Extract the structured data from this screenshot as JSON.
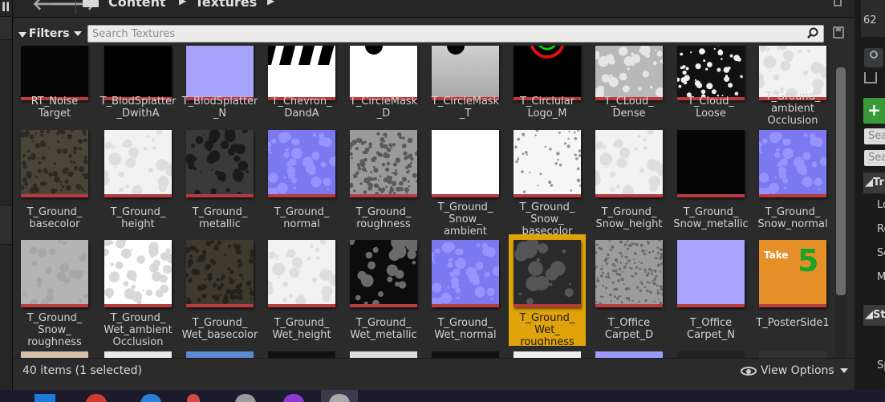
{
  "left_panel": {
    "menu_glyph": "ll"
  },
  "path": {
    "back_label": "🡐",
    "forward_label": "🡒",
    "crumbs": [
      "Content",
      "Textures"
    ]
  },
  "toolbar": {
    "filters_label": "Filters",
    "search_placeholder": "Search Textures"
  },
  "assets": [
    {
      "name": "RT_Noise\nTarget",
      "thumb": "black"
    },
    {
      "name": "T_BlodSplatter\n_DwithA",
      "thumb": "blood"
    },
    {
      "name": "T_BlodSplatter\n_N",
      "thumb": "blue-splat"
    },
    {
      "name": "T_Chevron_\nDandA",
      "thumb": "chevron"
    },
    {
      "name": "T_CircleMask\n_D",
      "thumb": "circle-white"
    },
    {
      "name": "T_CircleMask\n_T",
      "thumb": "circle-gray"
    },
    {
      "name": "T_Circlular\nLogo_M",
      "thumb": "logo"
    },
    {
      "name": "T_CLoud_\nDense",
      "thumb": "cloud-dense"
    },
    {
      "name": "T_Cloud_\nLoose",
      "thumb": "cloud-loose"
    },
    {
      "name": "T_Ground_\nambient\nOcclusion",
      "thumb": "white-rough"
    },
    {
      "name": "T_Ground_\nbasecolor",
      "thumb": "dirt"
    },
    {
      "name": "T_Ground_\nheight",
      "thumb": "white-rough"
    },
    {
      "name": "T_Ground_\nmetallic",
      "thumb": "dark-gray"
    },
    {
      "name": "T_Ground_\nnormal",
      "thumb": "normal"
    },
    {
      "name": "T_Ground_\nroughness",
      "thumb": "gray-noise"
    },
    {
      "name": "T_Ground_\nSnow_\nambient",
      "thumb": "white"
    },
    {
      "name": "T_Ground_\nSnow_\nbasecolor",
      "thumb": "snow-speck"
    },
    {
      "name": "T_Ground_\nSnow_height",
      "thumb": "white-rough"
    },
    {
      "name": "T_Ground_\nSnow_metallic",
      "thumb": "black"
    },
    {
      "name": "T_Ground_\nSnow_normal",
      "thumb": "normal"
    },
    {
      "name": "T_Ground_\nSnow_\nroughness",
      "thumb": "light-gray"
    },
    {
      "name": "T_Ground_\nWet_ambient\nOcclusion",
      "thumb": "white-wet"
    },
    {
      "name": "T_Ground_\nWet_basecolor",
      "thumb": "dirt-dark"
    },
    {
      "name": "T_Ground_\nWet_height",
      "thumb": "white-rough"
    },
    {
      "name": "T_Ground_\nWet_metallic",
      "thumb": "wet-metal"
    },
    {
      "name": "T_Ground_\nWet_normal",
      "thumb": "normal"
    },
    {
      "name": "T_Ground_\nWet_\nroughness",
      "thumb": "wet-rough"
    },
    {
      "name": "T_Office\nCarpet_D",
      "thumb": "carpet"
    },
    {
      "name": "T_Office\nCarpet_N",
      "thumb": "carpet-n"
    },
    {
      "name": "T_PosterSide1",
      "thumb": "poster"
    }
  ],
  "poster_text": {
    "take": "Take",
    "five": "5"
  },
  "selection": {
    "selected_index": 26,
    "selected_color": "#e1a30a"
  },
  "status": {
    "items_text": "40 items (1 selected)",
    "view_options_label": "View Options"
  },
  "right_panel": {
    "top_text": "62",
    "search_1": "Sea",
    "search_2": "Sea",
    "add_glyph": "+",
    "header_1": "Tr",
    "rows": [
      "Lo",
      "Ro",
      "Sc",
      "M"
    ],
    "header_2": "St",
    "bottom_text": "Sp"
  },
  "colors": {
    "panel": "#2b2b2b",
    "thumb_bar": "#ba3a3d",
    "search_bg": "#ececec"
  }
}
